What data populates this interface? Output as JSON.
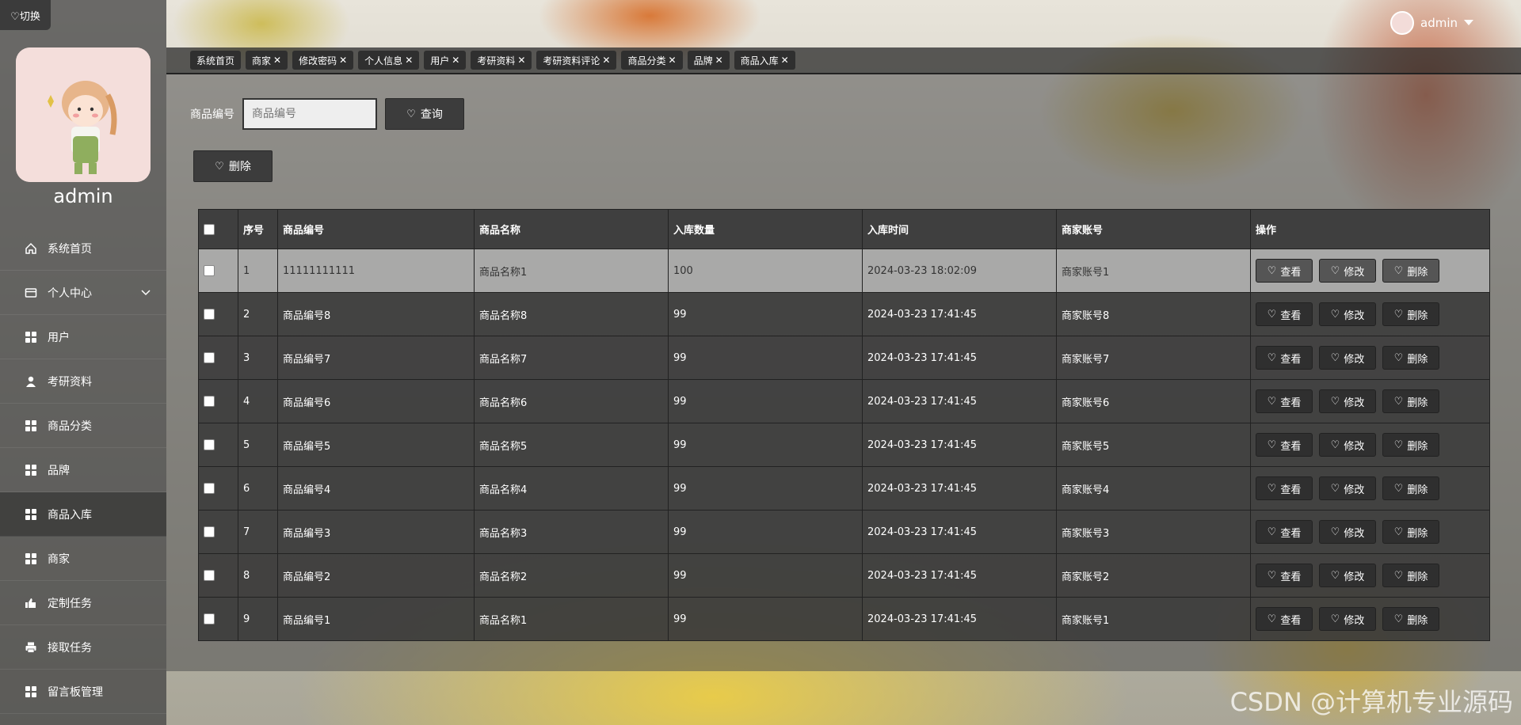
{
  "sidebar": {
    "switch_label": "♡切换",
    "user_name": "admin",
    "items": [
      {
        "label": "系统首页",
        "icon": "home-icon"
      },
      {
        "label": "个人中心",
        "icon": "card-icon",
        "has_chevron": true
      },
      {
        "label": "用户",
        "icon": "grid-icon"
      },
      {
        "label": "考研资料",
        "icon": "person-icon"
      },
      {
        "label": "商品分类",
        "icon": "grid-icon"
      },
      {
        "label": "品牌",
        "icon": "grid-icon"
      },
      {
        "label": "商品入库",
        "icon": "grid-icon",
        "active": true
      },
      {
        "label": "商家",
        "icon": "grid-icon"
      },
      {
        "label": "定制任务",
        "icon": "thumb-icon"
      },
      {
        "label": "接取任务",
        "icon": "printer-icon"
      },
      {
        "label": "留言板管理",
        "icon": "grid-icon"
      }
    ]
  },
  "header": {
    "user_name": "admin",
    "dropdown_icon": "caret-down-icon"
  },
  "tabs": [
    {
      "label": "系统首页",
      "closable": false
    },
    {
      "label": "商家",
      "closable": true
    },
    {
      "label": "修改密码",
      "closable": true
    },
    {
      "label": "个人信息",
      "closable": true
    },
    {
      "label": "用户",
      "closable": true
    },
    {
      "label": "考研资料",
      "closable": true
    },
    {
      "label": "考研资料评论",
      "closable": true
    },
    {
      "label": "商品分类",
      "closable": true
    },
    {
      "label": "品牌",
      "closable": true
    },
    {
      "label": "商品入库",
      "closable": true
    }
  ],
  "search": {
    "label": "商品编号",
    "placeholder": "商品编号",
    "value": "",
    "query_label": "查询"
  },
  "toolbar": {
    "delete_label": "删除"
  },
  "table": {
    "columns": [
      "序号",
      "商品编号",
      "商品名称",
      "入库数量",
      "入库时间",
      "商家账号",
      "操作"
    ],
    "rows": [
      [
        "1",
        "11111111111",
        "商品名称1",
        "100",
        "2024-03-23 18:02:09",
        "商家账号1"
      ],
      [
        "2",
        "商品编号8",
        "商品名称8",
        "99",
        "2024-03-23 17:41:45",
        "商家账号8"
      ],
      [
        "3",
        "商品编号7",
        "商品名称7",
        "99",
        "2024-03-23 17:41:45",
        "商家账号7"
      ],
      [
        "4",
        "商品编号6",
        "商品名称6",
        "99",
        "2024-03-23 17:41:45",
        "商家账号6"
      ],
      [
        "5",
        "商品编号5",
        "商品名称5",
        "99",
        "2024-03-23 17:41:45",
        "商家账号5"
      ],
      [
        "6",
        "商品编号4",
        "商品名称4",
        "99",
        "2024-03-23 17:41:45",
        "商家账号4"
      ],
      [
        "7",
        "商品编号3",
        "商品名称3",
        "99",
        "2024-03-23 17:41:45",
        "商家账号3"
      ],
      [
        "8",
        "商品编号2",
        "商品名称2",
        "99",
        "2024-03-23 17:41:45",
        "商家账号2"
      ],
      [
        "9",
        "商品编号1",
        "商品名称1",
        "99",
        "2024-03-23 17:41:45",
        "商家账号1"
      ]
    ],
    "actions": [
      "查看",
      "修改",
      "删除"
    ]
  },
  "watermark": "CSDN @计算机专业源码"
}
